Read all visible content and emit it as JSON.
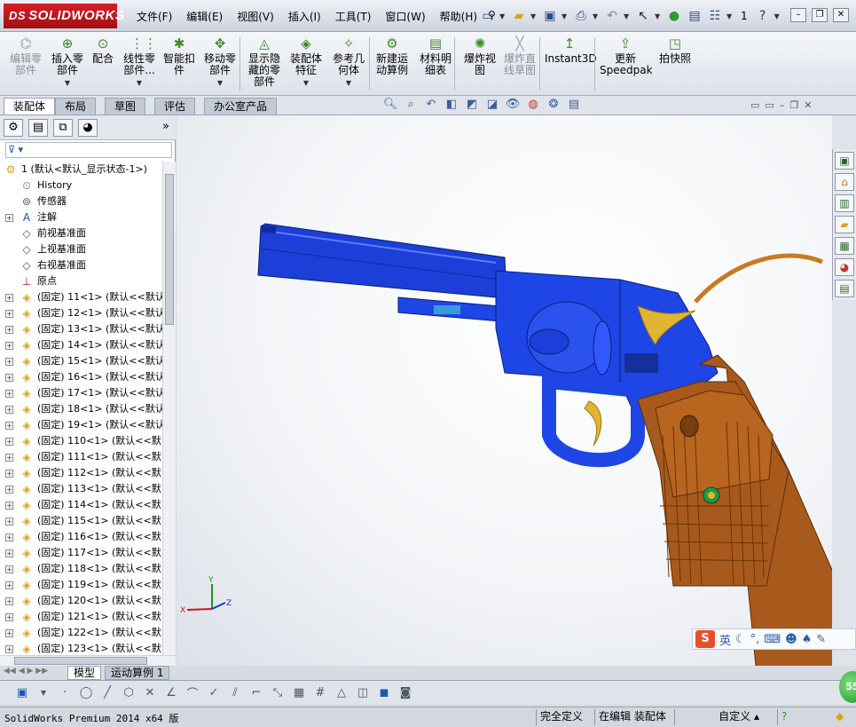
{
  "app": {
    "logo_text": "SOLIDWORKS",
    "logo_prefix": "DS"
  },
  "menu": [
    "文件(F)",
    "编辑(E)",
    "视图(V)",
    "插入(I)",
    "工具(T)",
    "窗口(W)",
    "帮助(H)"
  ],
  "toolbar_counter": "1",
  "command_manager": [
    {
      "label": "编辑零\n部件",
      "icon": "edit-component-icon",
      "disabled": true
    },
    {
      "label": "插入零\n部件",
      "icon": "insert-component-icon",
      "disabled": false
    },
    {
      "label": "配合",
      "icon": "mate-icon",
      "disabled": false
    },
    {
      "label": "线性零\n部件...",
      "icon": "linear-pattern-icon",
      "disabled": false
    },
    {
      "label": "智能扣\n件",
      "icon": "smart-fasteners-icon",
      "disabled": false
    },
    {
      "label": "移动零\n部件",
      "icon": "move-component-icon",
      "disabled": false
    },
    {
      "label": "显示隐\n藏的零\n部件",
      "icon": "show-hidden-icon",
      "disabled": false
    },
    {
      "label": "装配体\n特征",
      "icon": "assembly-features-icon",
      "disabled": false
    },
    {
      "label": "参考几\n何体",
      "icon": "reference-geometry-icon",
      "disabled": false
    },
    {
      "label": "新建运\n动算例",
      "icon": "new-motion-study-icon",
      "disabled": false
    },
    {
      "label": "材料明\n细表",
      "icon": "bom-icon",
      "disabled": false
    },
    {
      "label": "爆炸视\n图",
      "icon": "exploded-view-icon",
      "disabled": false
    },
    {
      "label": "爆炸直\n线草图",
      "icon": "explode-line-sketch-icon",
      "disabled": true
    },
    {
      "label": "Instant3D",
      "icon": "instant3d-icon",
      "disabled": false
    },
    {
      "label": "更新\nSpeedpak",
      "icon": "speedpak-icon",
      "disabled": false
    },
    {
      "label": "拍快照",
      "icon": "snapshot-icon",
      "disabled": false
    }
  ],
  "tabs": [
    "装配体",
    "布局",
    "草图",
    "评估",
    "办公室产品"
  ],
  "tree": {
    "root": "1  (默认<默认_显示状态-1>)",
    "fixed_items": [
      {
        "label": "History",
        "icon": "history-icon"
      },
      {
        "label": "传感器",
        "icon": "sensor-icon"
      },
      {
        "label": "注解",
        "icon": "annotation-icon"
      },
      {
        "label": "前视基准面",
        "icon": "plane-icon"
      },
      {
        "label": "上视基准面",
        "icon": "plane-icon"
      },
      {
        "label": "右视基准面",
        "icon": "plane-icon"
      },
      {
        "label": "原点",
        "icon": "origin-icon"
      }
    ],
    "components": [
      "(固定) 11<1> (默认<<默认",
      "(固定) 12<1> (默认<<默认",
      "(固定) 13<1> (默认<<默认",
      "(固定) 14<1> (默认<<默认",
      "(固定) 15<1> (默认<<默认",
      "(固定) 16<1> (默认<<默认",
      "(固定) 17<1> (默认<<默认",
      "(固定) 18<1> (默认<<默认",
      "(固定) 19<1> (默认<<默认",
      "(固定) 110<1> (默认<<默",
      "(固定) 111<1> (默认<<默",
      "(固定) 112<1> (默认<<默",
      "(固定) 113<1> (默认<<默",
      "(固定) 114<1> (默认<<默",
      "(固定) 115<1> (默认<<默",
      "(固定) 116<1> (默认<<默",
      "(固定) 117<1> (默认<<默",
      "(固定) 118<1> (默认<<默",
      "(固定) 119<1> (默认<<默",
      "(固定) 120<1> (默认<<默",
      "(固定) 121<1> (默认<<默",
      "(固定) 122<1> (默认<<默",
      "(固定) 123<1> (默认<<默"
    ]
  },
  "model_tabs": [
    "模型",
    "运动算例 1"
  ],
  "triad": {
    "x": "X",
    "y": "Y",
    "z": "Z"
  },
  "ime": {
    "logo": "S",
    "lang": "英"
  },
  "green_ball_value": "55",
  "status": {
    "product": "SolidWorks Premium 2014 x64 版",
    "definition": "完全定义",
    "editing": "在编辑 装配体",
    "units": "自定义"
  },
  "colors": {
    "barrel_blue": "#1b3fd8",
    "grip_brown": "#a85a1c",
    "gold": "#e0b530",
    "logo_red": "#c8161e"
  }
}
